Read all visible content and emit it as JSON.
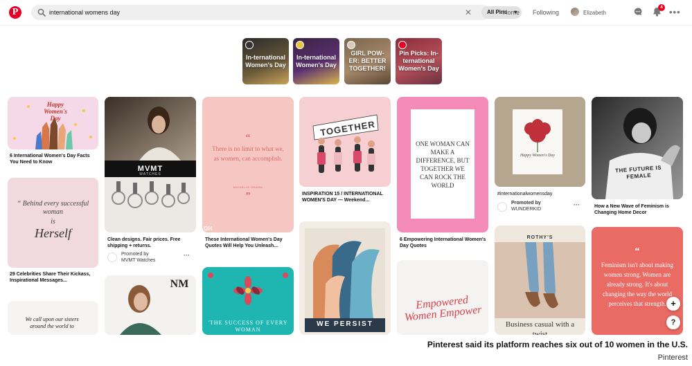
{
  "header": {
    "logo_letter": "P",
    "search_value": "international womens day",
    "scope_label": "All Pins",
    "nav": {
      "home": "Home",
      "following": "Following",
      "user": "Elizabeth"
    },
    "notification_count": "4"
  },
  "stories": [
    {
      "label": "In-ternational Women's Day"
    },
    {
      "label": "In-ternational Women's Day"
    },
    {
      "label": "GIRL POW-ER: BETTER TOGETHER!"
    },
    {
      "label": "Pin Picks: In-ternational Women's Day"
    }
  ],
  "pins": {
    "c1": {
      "p1_art": "Happy Women's Day",
      "p1_caption": "6 International Women's Day Facts You Need to Know",
      "p2_quote_a": "“ Behind every successful woman",
      "p2_quote_b": "is",
      "p2_quote_c": "Herself",
      "p2_caption": "29 Celebrities Share Their Kickass, Inspirational Messages...",
      "p3_art": "We call upon our sisters around the world to"
    },
    "c2": {
      "brand": "MVMT",
      "brand_sub": "WATCHES",
      "caption": "Clean designs. Fair prices. Free shipping + returns.",
      "promoted_label": "Promoted by",
      "promoted_name": "MVMT Watches",
      "nm_logo": "NM"
    },
    "c3": {
      "quote": "There is no limit to what we, as women, can accomplish.",
      "quote_emph": "limit",
      "author": "MICHELLE OBAMA",
      "corner": "OH",
      "caption": "These International Women's Day Quotes Will Help You Unleash...",
      "teal_text": "'THE SUCCESS OF EVERY WOMAN"
    },
    "c4": {
      "banner": "TOGETHER",
      "caption": "INSPIRATION 15 / INTERNATIONAL WOMEN'S DAY — Weekend...",
      "persist": "WE PERSIST"
    },
    "c5": {
      "quote": "ONE WOMAN CAN MAKE A DIFFERENCE, BUT TOGETHER WE CAN ROCK THE WORLD",
      "caption": "6 Empowering International Women's Day Quotes",
      "empowered": "Empowered Women Empower"
    },
    "c6": {
      "card_text": "Happy Women's Day",
      "hashtag": "#internationalwomensday",
      "promoted_label": "Promoted by",
      "promoted_name": "WUNDERKID",
      "rothys": "ROTHY'S",
      "rothys_caption": "Business casual with a twist"
    },
    "c7": {
      "shirt": "THE FUTURE IS FEMALE",
      "caption": "How a New Wave of Feminism is Changing Home Decor",
      "quote": "Feminism isn't about making women strong. Women are already strong. It's about changing the way the world perceives that strength."
    }
  },
  "footer": {
    "caption": "Pinterest said its platform reaches six out of 10 women in the U.S.",
    "credit": "Pinterest"
  },
  "colors": {
    "brand_red": "#e60023"
  }
}
